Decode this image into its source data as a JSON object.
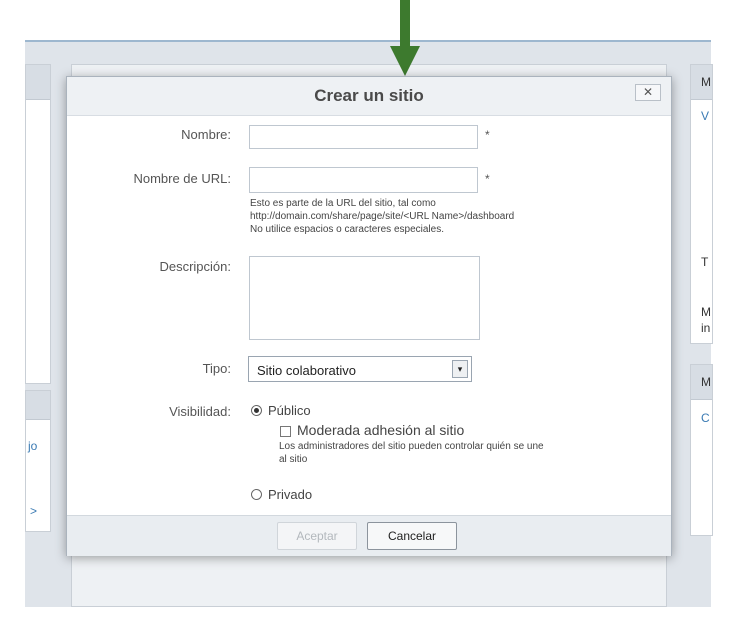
{
  "background": {
    "right_panel_1": {
      "head": "M",
      "link": "V",
      "text_1": "T",
      "text_2": "M",
      "text_3": "in"
    },
    "right_panel_2": {
      "head": "M",
      "link": "C"
    },
    "left_fragments": {
      "text_1": "jo",
      "text_2": ">"
    }
  },
  "dialog": {
    "title": "Crear un sitio",
    "close_label": "✕",
    "fields": {
      "nombre": {
        "label": "Nombre:",
        "value": "",
        "required_mark": "*"
      },
      "url": {
        "label": "Nombre de URL:",
        "value": "",
        "required_mark": "*",
        "help_1": "Esto es parte de la URL del sitio, tal como",
        "help_2": "http://domain.com/share/page/site/<URL Name>/dashboard",
        "help_3": "No utilice espacios o caracteres especiales."
      },
      "descripcion": {
        "label": "Descripción:",
        "value": ""
      },
      "tipo": {
        "label": "Tipo:",
        "selected": "Sitio colaborativo",
        "arrow_icon": "▾"
      },
      "visibilidad": {
        "label": "Visibilidad:",
        "public_label": "Público",
        "moderated_label": "Moderada adhesión al sitio",
        "moderated_help_1": "Los administradores del sitio pueden controlar quién se une",
        "moderated_help_2": "al sitio",
        "private_label": "Privado"
      }
    },
    "buttons": {
      "accept": "Aceptar",
      "cancel": "Cancelar"
    }
  },
  "colors": {
    "arrow": "#3d7a2e",
    "titlebar": "#eef1f4"
  }
}
